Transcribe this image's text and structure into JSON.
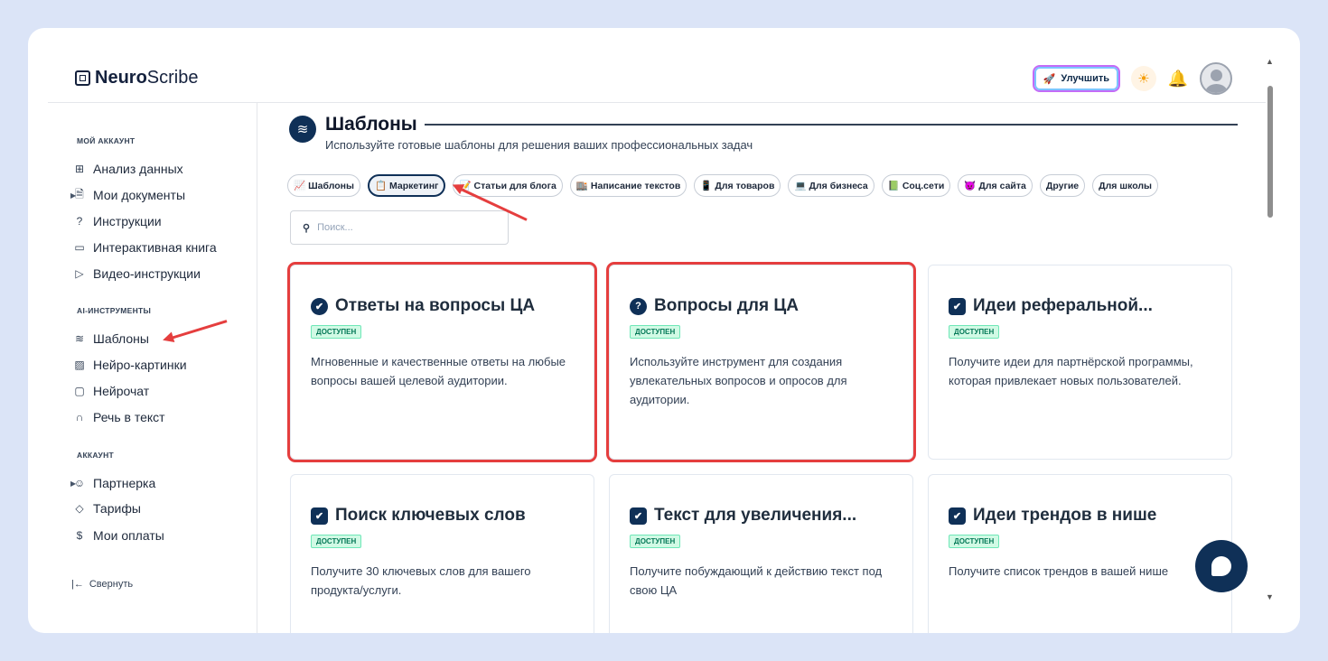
{
  "app": {
    "logo_bold": "Neuro",
    "logo_rest": "Scribe"
  },
  "topbar": {
    "upgrade_label": "Улучшить",
    "upgrade_icon": "rocket-icon",
    "theme_icon": "sun-icon",
    "notify_icon": "bell-icon"
  },
  "sidebar": {
    "section1": "мой аккаунт",
    "items1": [
      {
        "label": "Анализ данных",
        "icon": "grid-icon"
      },
      {
        "label": "Мои документы",
        "icon": "document-icon"
      },
      {
        "label": "Инструкции",
        "icon": "help-icon"
      },
      {
        "label": "Интерактивная книга",
        "icon": "book-icon"
      },
      {
        "label": "Видео-инструкции",
        "icon": "video-icon"
      }
    ],
    "section2": "ai-инструменты",
    "items2": [
      {
        "label": "Шаблоны",
        "icon": "layers-icon"
      },
      {
        "label": "Нейро-картинки",
        "icon": "image-icon"
      },
      {
        "label": "Нейрочат",
        "icon": "chat-icon"
      },
      {
        "label": "Речь в текст",
        "icon": "headphones-icon"
      }
    ],
    "section3": "аккаунт",
    "items3": [
      {
        "label": "Партнерка",
        "icon": "users-icon"
      },
      {
        "label": "Тарифы",
        "icon": "tag-icon"
      },
      {
        "label": "Мои оплаты",
        "icon": "dollar-icon"
      }
    ],
    "collapse_label": "Свернуть"
  },
  "page": {
    "title": "Шаблоны",
    "subtitle": "Используйте готовые шаблоны для решения ваших профессиональных задач",
    "search_placeholder": "Поиск..."
  },
  "chips": [
    {
      "label": "Шаблоны",
      "icon": "📈"
    },
    {
      "label": "Маркетинг",
      "icon": "📋"
    },
    {
      "label": "Статьи для блога",
      "icon": "📝"
    },
    {
      "label": "Написание текстов",
      "icon": "🏬"
    },
    {
      "label": "Для товаров",
      "icon": "📱"
    },
    {
      "label": "Для бизнеса",
      "icon": "💻"
    },
    {
      "label": "Соц.сети",
      "icon": "📗"
    },
    {
      "label": "Для сайта",
      "icon": "😈"
    },
    {
      "label": "Другие",
      "icon": ""
    },
    {
      "label": "Для школы",
      "icon": ""
    }
  ],
  "cards": [
    {
      "title": "Ответы на вопросы ЦА",
      "badge": "ДОСТУПЕН",
      "desc": "Мгновенные и качественные ответы на любые вопросы вашей целевой аудитории.",
      "icon": "check-circle-icon"
    },
    {
      "title": "Вопросы для ЦА",
      "badge": "ДОСТУПЕН",
      "desc": "Используйте инструмент для создания увлекательных вопросов и опросов для аудитории.",
      "icon": "question-icon"
    },
    {
      "title": "Идеи реферальной...",
      "badge": "ДОСТУПЕН",
      "desc": "Получите идеи для партнёрской программы, которая привлекает новых пользователей.",
      "icon": "checkbox-icon"
    },
    {
      "title": "Поиск ключевых слов",
      "badge": "ДОСТУПЕН",
      "desc": "Получите 30 ключевых слов для вашего продукта/услуги.",
      "icon": "checkbox-icon"
    },
    {
      "title": "Текст для увеличения...",
      "badge": "ДОСТУПЕН",
      "desc": "Получите побуждающий к действию текст под свою ЦА",
      "icon": "checkbox-icon"
    },
    {
      "title": "Идеи трендов в нише",
      "badge": "ДОСТУПЕН",
      "desc": "Получите список трендов в вашей нише",
      "icon": "checkbox-icon"
    }
  ]
}
